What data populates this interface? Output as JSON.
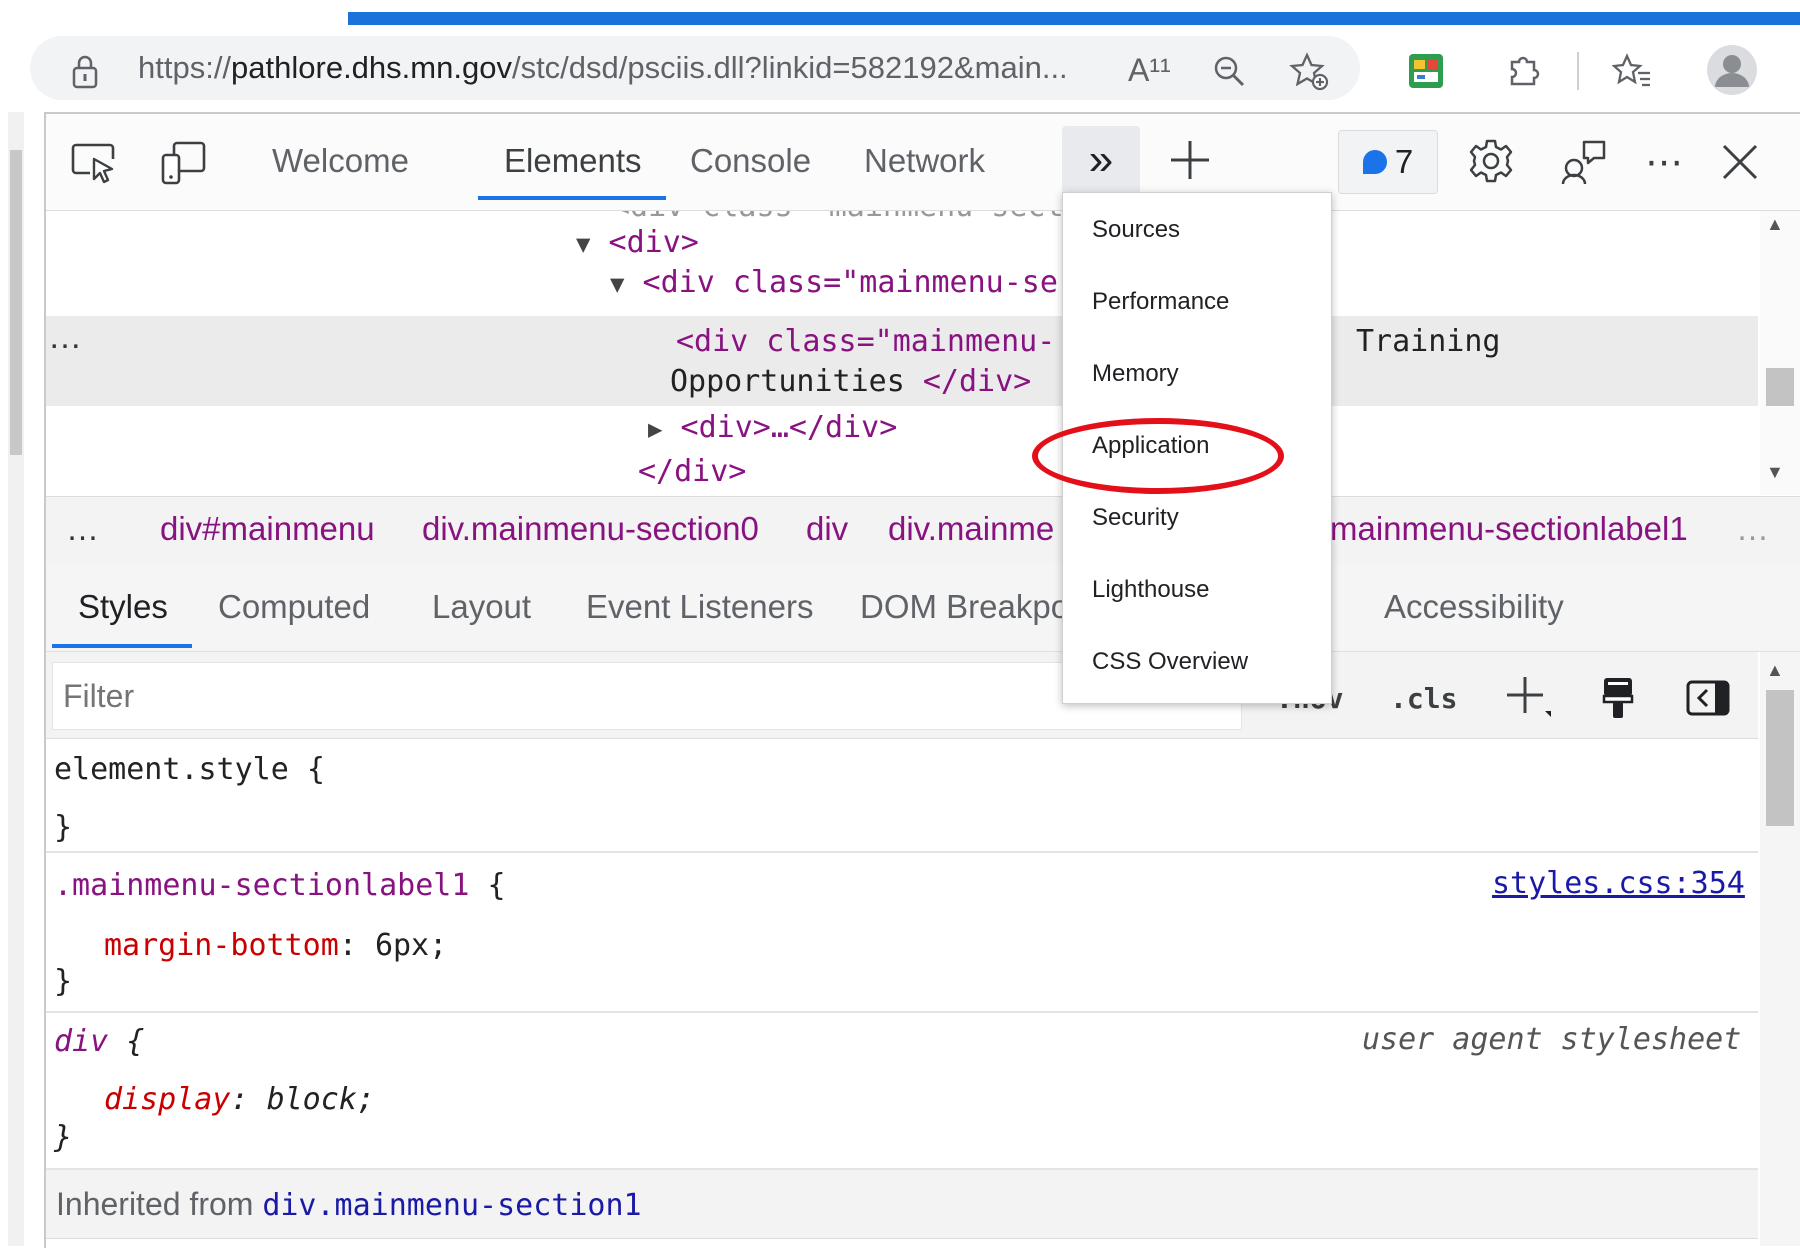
{
  "browser": {
    "url_prefix": "https://",
    "url_host": "pathlore.dhs.mn.gov",
    "url_rest": "/stc/dsd/psciis.dll?linkid=582192&main...",
    "read_aloud_label": "A¹¹"
  },
  "devtools": {
    "tabs": [
      "Welcome",
      "Elements",
      "Console",
      "Network"
    ],
    "active_tab": "Elements",
    "more_tabs_glyph": "»",
    "new_tab_glyph": "+",
    "issues_count": "7",
    "more_glyph": "⋯",
    "close_glyph": "✕"
  },
  "dom_tree": {
    "clipped_line": "<div class=\"mainmenu-secti",
    "line_div_open": "<div>",
    "line_section_prefix": "<div class=\"mainmenu-se",
    "sel_line1": "<div class=\"mainmenu-",
    "sel_line1_tail": "Training",
    "sel_line2_text": "Opportunities ",
    "sel_line2_close": "</div>",
    "collapsed_div": "<div>…</div>",
    "closing_div": "</div>",
    "ellipsis": "…"
  },
  "breadcrumbs": {
    "left_ellipsis": "…",
    "items": [
      "div#mainmenu",
      "div.mainmenu-section0",
      "div",
      "div.mainme",
      "mainmenu-sectionlabel1"
    ],
    "right_ellipsis": "…"
  },
  "styles_tabs": {
    "items": [
      "Styles",
      "Computed",
      "Layout",
      "Event Listeners",
      "DOM Breakpo",
      "Accessibility"
    ],
    "active": "Styles"
  },
  "filter": {
    "placeholder": "Filter",
    "hov_label": ":hov",
    "cls_label": ".cls"
  },
  "rules": [
    {
      "selector": "element.style",
      "open": " {",
      "close": "}"
    },
    {
      "selector": ".mainmenu-sectionlabel1",
      "open": " {",
      "property": "margin-bottom",
      "value": "6px",
      "source": "styles.css:354",
      "close": "}"
    },
    {
      "selector": "div",
      "open": " {",
      "property": "display",
      "value": "block",
      "source": "user agent stylesheet",
      "close": "}"
    }
  ],
  "inherited": {
    "label": "Inherited from ",
    "selector": "div.mainmenu-section1"
  },
  "overflow_menu": {
    "items": [
      "Sources",
      "Performance",
      "Memory",
      "Application",
      "Security",
      "Lighthouse",
      "CSS Overview"
    ],
    "highlighted": "Application"
  },
  "colors": {
    "accent": "#1a73e8",
    "tag": "#881280",
    "attribute": "#994500",
    "attribute_value": "#1a1aa6",
    "annotation": "#e3101a"
  }
}
